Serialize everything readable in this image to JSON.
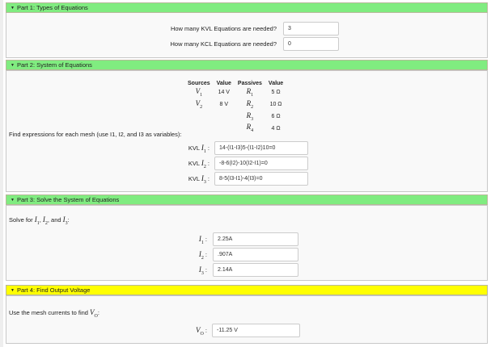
{
  "part1": {
    "title": "Part 1: Types of Equations",
    "kvl_q": "How many KVL Equations are needed?",
    "kvl_val": "3",
    "kcl_q": "How many KCL Equations are needed?",
    "kcl_val": "0"
  },
  "part2": {
    "title": "Part 2: System of Equations",
    "table": {
      "headers": [
        "Sources",
        "Value",
        "Passives",
        "Value"
      ],
      "rows": [
        {
          "src": "V",
          "ss": "1",
          "sv": "14 V",
          "p": "R",
          "ps": "1",
          "pv": "5 Ω"
        },
        {
          "src": "V",
          "ss": "2",
          "sv": "8 V",
          "p": "R",
          "ps": "2",
          "pv": "10 Ω"
        },
        {
          "src": "",
          "ss": "",
          "sv": "",
          "p": "R",
          "ps": "3",
          "pv": "6 Ω"
        },
        {
          "src": "",
          "ss": "",
          "sv": "",
          "p": "R",
          "ps": "4",
          "pv": "4 Ω"
        }
      ]
    },
    "instruction": "Find expressions for each mesh (use I1, I2, and I3 as variables):",
    "kvl_prefix": "KVL",
    "sym": "I",
    "eqs": [
      {
        "sub": "1",
        "value": "14-(I1-I3)5-(I1-I2)10=0"
      },
      {
        "sub": "2",
        "value": "-8-6(I2)-10(I2-I1)=0"
      },
      {
        "sub": "3",
        "value": "8-5(I3-I1)-4(I3)=0"
      }
    ]
  },
  "part3": {
    "title": "Part 3: Solve the System of Equations",
    "instr_a": "Solve for ",
    "instr_b": ", and ",
    "sym": "I",
    "currents": [
      {
        "sub": "1",
        "value": "2.25A"
      },
      {
        "sub": "2",
        "value": ".907A"
      },
      {
        "sub": "3",
        "value": "2.14A"
      }
    ]
  },
  "part4": {
    "title": "Part 4: Find Output Voltage",
    "instr": "Use the mesh currents to find ",
    "sym": "V",
    "sub": "O",
    "value": "-11.25 V"
  },
  "colors": {
    "green": "#80ec80",
    "yellow": "#ffff00"
  }
}
